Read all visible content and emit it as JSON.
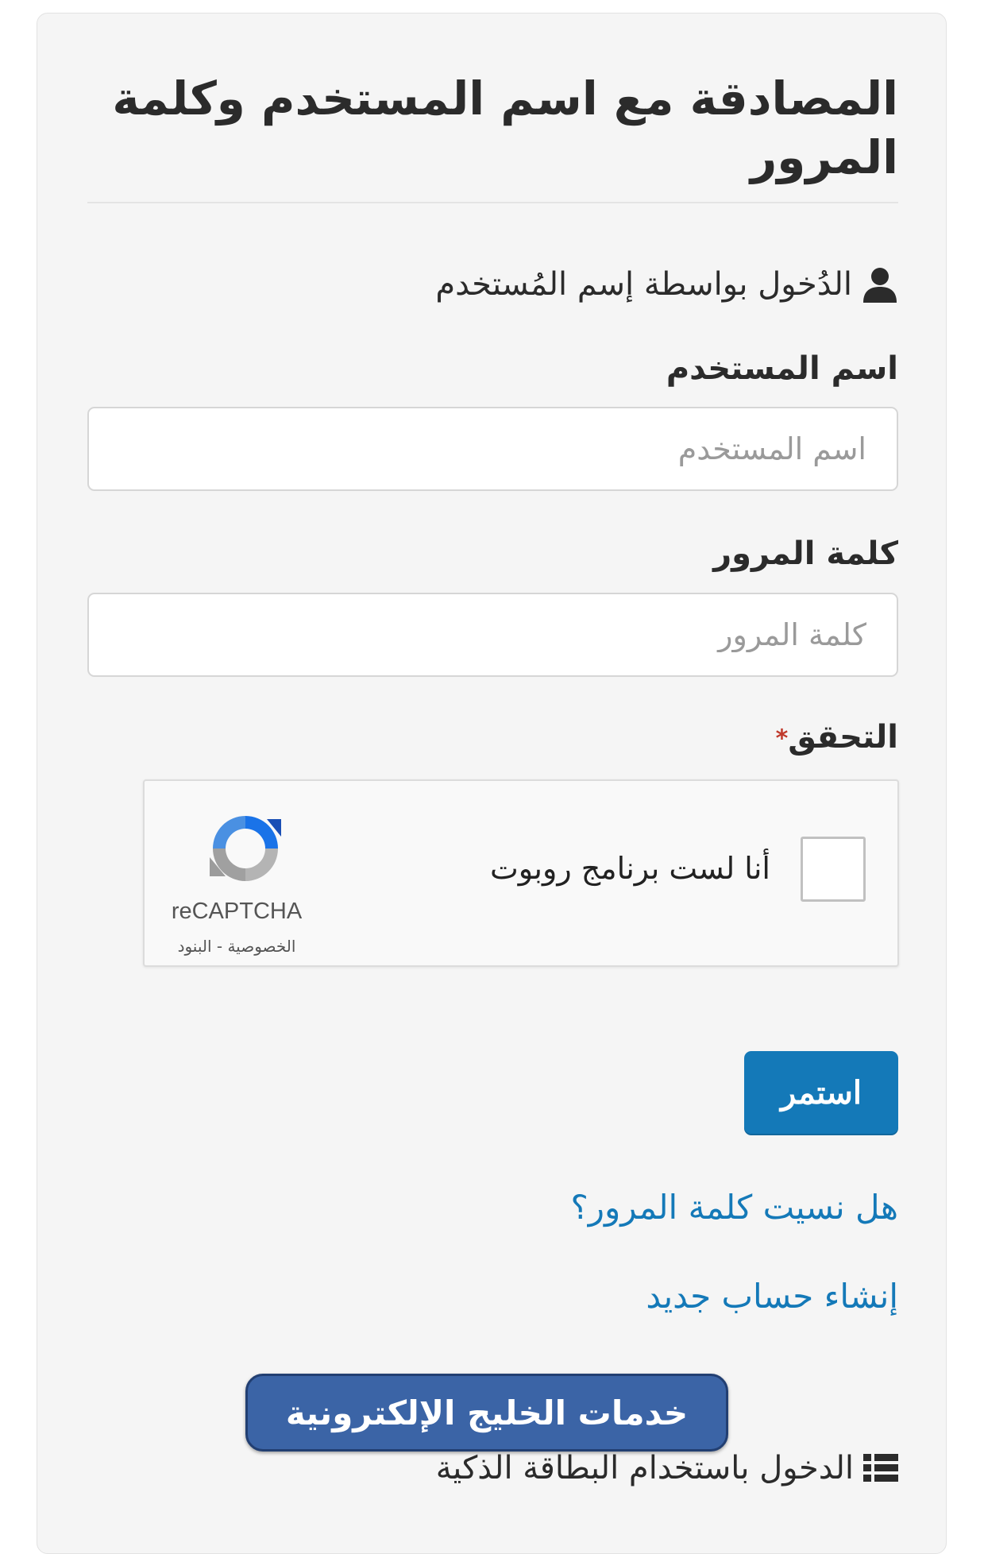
{
  "page": {
    "title": "المصادقة مع اسم المستخدم وكلمة المرور",
    "section_heading": "الدُخول بواسطة إسم المُستخدم"
  },
  "form": {
    "username_label": "اسم المستخدم",
    "username_placeholder": "اسم المستخدم",
    "username_value": "",
    "password_label": "كلمة المرور",
    "password_placeholder": "كلمة المرور",
    "password_value": "",
    "verification_label": "التحقق",
    "required_marker": "*"
  },
  "recaptcha": {
    "checkbox_text": "أنا لست برنامج روبوت",
    "brand": "reCAPTCHA",
    "links": "الخصوصية - البنود",
    "checked": false
  },
  "actions": {
    "continue_label": "استمر",
    "forgot_password": "هل نسيت كلمة المرور؟",
    "create_account": "إنشاء حساب جديد",
    "gulf_services": "خدمات الخليج الإلكترونية",
    "smart_card_login": "الدخول باستخدام البطاقة الذكية"
  },
  "colors": {
    "accent": "#1479b8",
    "gulf_button": "#3b64a6",
    "panel_bg": "#f5f5f5",
    "required": "#c0392b"
  },
  "icons": {
    "section": "user-icon",
    "smart_card": "list-icon",
    "recaptcha": "recaptcha-logo-icon"
  }
}
